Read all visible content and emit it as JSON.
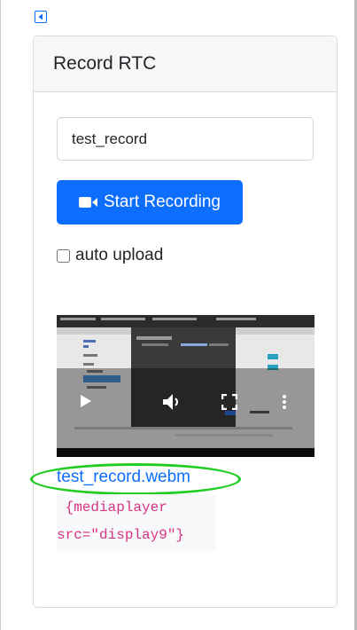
{
  "card": {
    "title": "Record RTC"
  },
  "recording": {
    "name_value": "test_record",
    "start_button_label": "Start Recording",
    "auto_upload_label": "auto upload",
    "auto_upload_checked": false
  },
  "video": {
    "file_name": "test_record.webm"
  },
  "snippet": {
    "line1": " {mediaplayer",
    "line2": "src=\"display9\"}"
  },
  "colors": {
    "primary": "#0d6efd",
    "highlight": "#22cc22",
    "code": "#d63384"
  }
}
